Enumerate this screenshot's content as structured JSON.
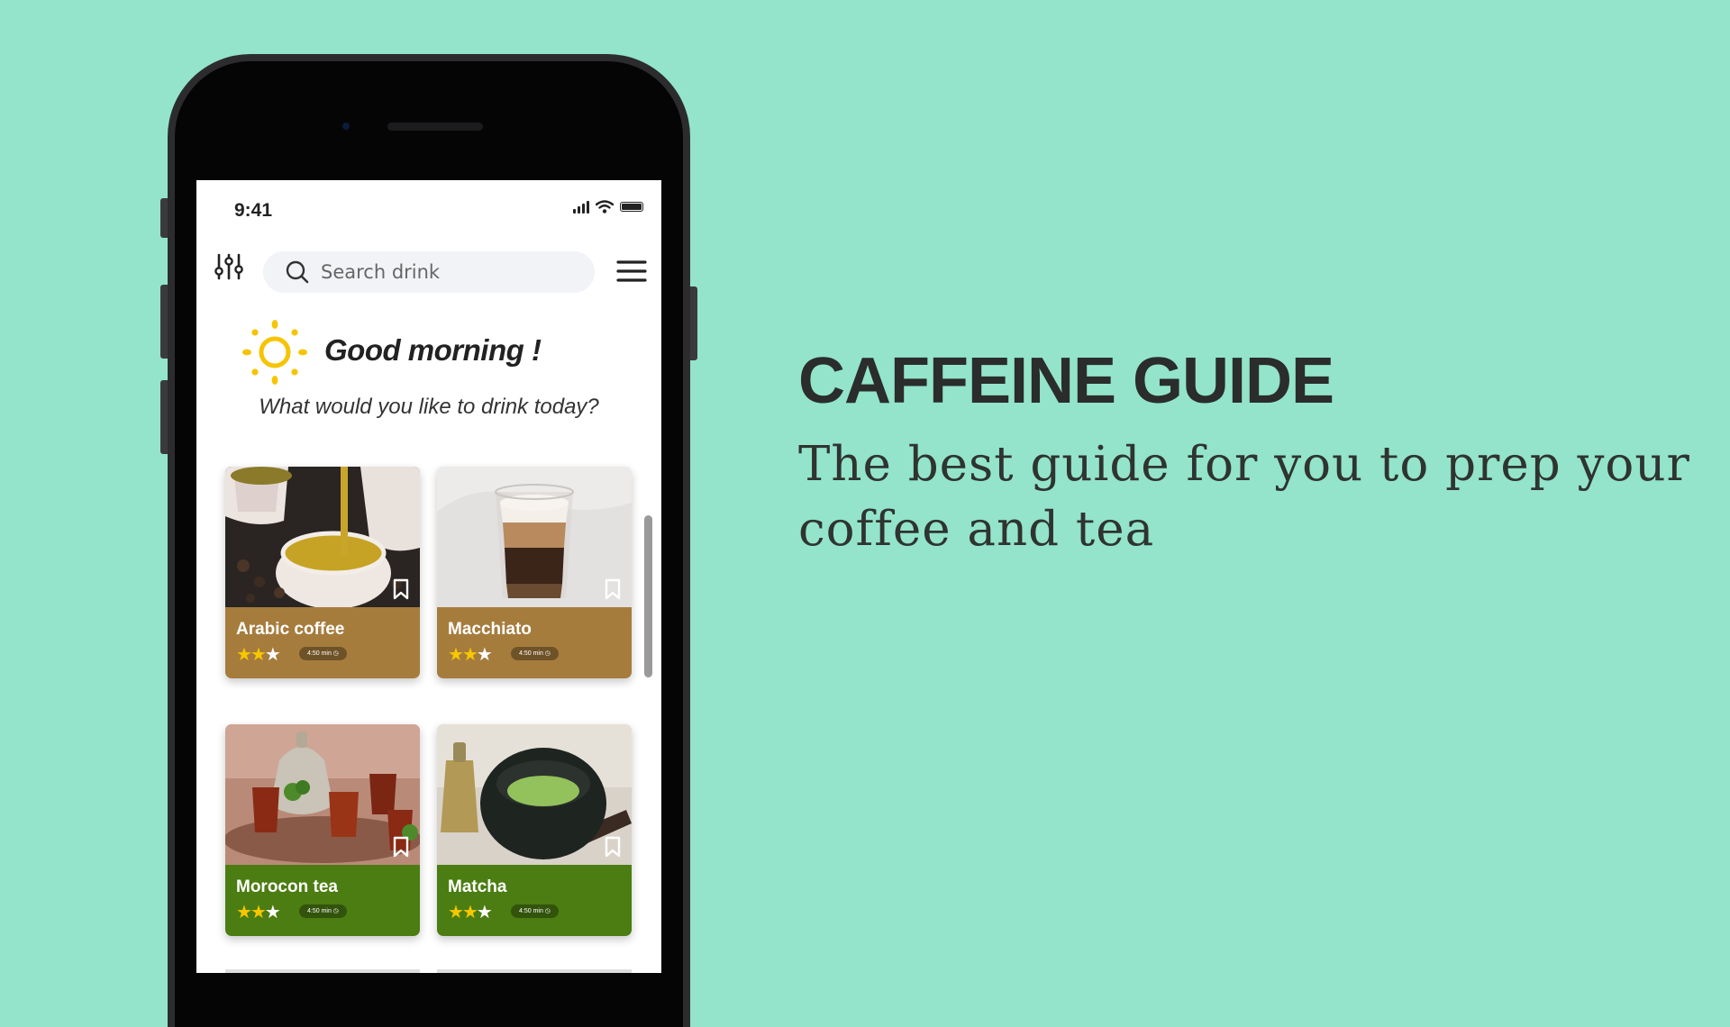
{
  "status": {
    "time": "9:41"
  },
  "search": {
    "placeholder": "Search drink"
  },
  "greeting": {
    "title": "Good morning !",
    "subtitle": "What would you like to drink today?"
  },
  "drinks": [
    {
      "name": "Arabic coffee",
      "rating": 2,
      "max_rating": 3,
      "time": "4:50 min",
      "color": "#a67c3d"
    },
    {
      "name": "Macchiato",
      "rating": 2,
      "max_rating": 3,
      "time": "4:50 min",
      "color": "#a67c3d"
    },
    {
      "name": "Morocon tea",
      "rating": 2,
      "max_rating": 3,
      "time": "4:50 min",
      "color": "#4b7d12"
    },
    {
      "name": "Matcha",
      "rating": 2,
      "max_rating": 3,
      "time": "4:50 min",
      "color": "#4b7d12"
    }
  ],
  "hero": {
    "title": "CAFFEINE GUIDE",
    "subtitle": "The best guide for you to prep your coffee and tea"
  },
  "colors": {
    "background": "#93e4ca",
    "coffee_card": "#a67c3d",
    "tea_card": "#4b7d12",
    "star": "#f7c700"
  }
}
